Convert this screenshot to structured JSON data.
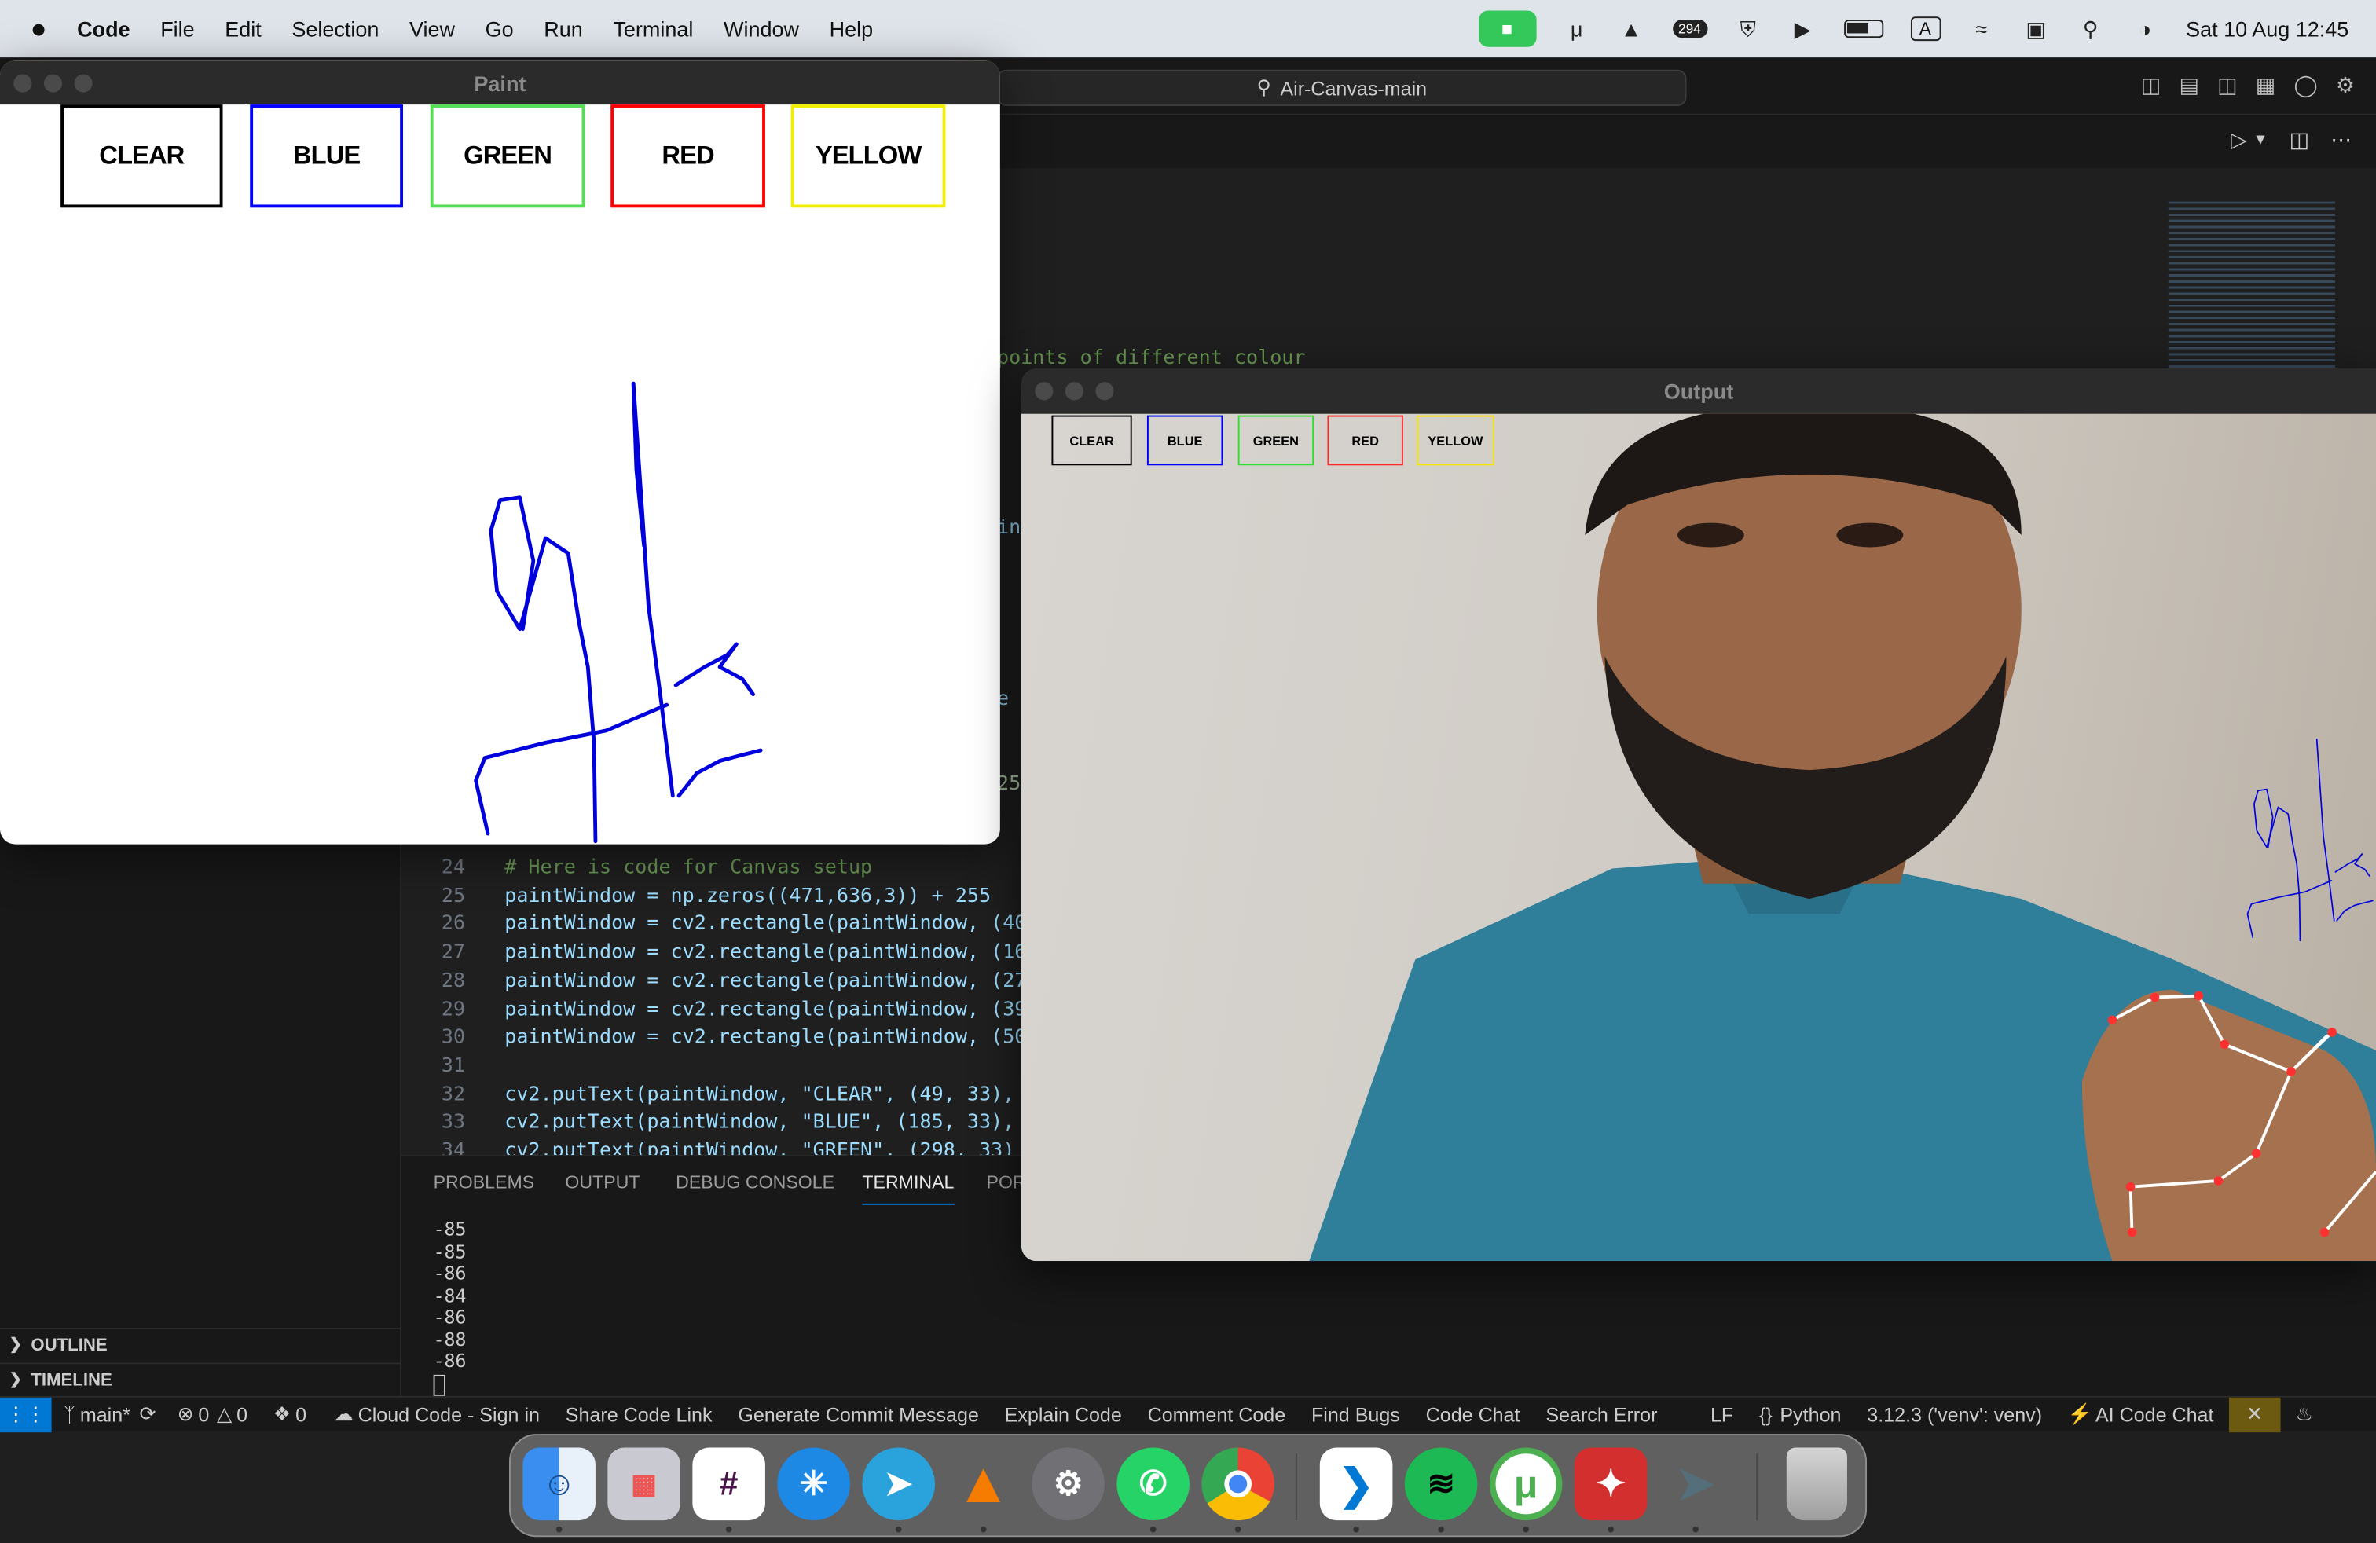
{
  "menubar": {
    "app_name": "Code",
    "items": [
      "File",
      "Edit",
      "Selection",
      "View",
      "Go",
      "Run",
      "Terminal",
      "Window",
      "Help"
    ],
    "badge_count": "294",
    "input_indicator": "A",
    "datetime": "Sat 10 Aug  12:45"
  },
  "vscode": {
    "command_center": "Air-Canvas-main",
    "code_fragments": {
      "comment_points": "points of different colour",
      "frag_a": "in",
      "frag_b": "e",
      "frag_c": "25"
    },
    "code_lines": [
      {
        "num": "24",
        "text": "# Here is code for Canvas setup"
      },
      {
        "num": "25",
        "text": "paintWindow = np.zeros((471,636,3)) + 255"
      },
      {
        "num": "26",
        "text": "paintWindow = cv2.rectangle(paintWindow, (40,"
      },
      {
        "num": "27",
        "text": "paintWindow = cv2.rectangle(paintWindow, (160,"
      },
      {
        "num": "28",
        "text": "paintWindow = cv2.rectangle(paintWindow, (275,"
      },
      {
        "num": "29",
        "text": "paintWindow = cv2.rectangle(paintWindow, (390,"
      },
      {
        "num": "30",
        "text": "paintWindow = cv2.rectangle(paintWindow, (505,"
      },
      {
        "num": "31",
        "text": ""
      },
      {
        "num": "32",
        "text": "cv2.putText(paintWindow, \"CLEAR\", (49, 33), c"
      },
      {
        "num": "33",
        "text": "cv2.putText(paintWindow, \"BLUE\", (185, 33), c"
      },
      {
        "num": "34",
        "text": "cv2.putText(paintWindow, \"GREEN\", (298, 33)"
      }
    ],
    "panel_tabs": [
      "PROBLEMS",
      "OUTPUT",
      "DEBUG CONSOLE",
      "TERMINAL",
      "POR"
    ],
    "terminal_lines": [
      "-85",
      "-85",
      "-86",
      "-84",
      "-86",
      "-88",
      "-86"
    ],
    "sidebar_sections": [
      "OUTLINE",
      "TIMELINE"
    ],
    "status": {
      "branch": "main*",
      "errors": "0",
      "warnings": "0",
      "ports": "0",
      "cloud_code": "Cloud Code - Sign in",
      "share": "Share Code Link",
      "commit": "Generate Commit Message",
      "explain": "Explain Code",
      "comment": "Comment Code",
      "bugs": "Find Bugs",
      "chat": "Code Chat",
      "search_error": "Search Error",
      "eol": "LF",
      "language": "Python",
      "interpreter": "3.12.3 ('venv': venv)",
      "ai_chat": "AI Code Chat"
    }
  },
  "paint_window": {
    "title": "Paint",
    "buttons": [
      {
        "label": "CLEAR",
        "color": "#000000"
      },
      {
        "label": "BLUE",
        "color": "#0000ff"
      },
      {
        "label": "GREEN",
        "color": "#00ff00"
      },
      {
        "label": "RED",
        "color": "#ff0000"
      },
      {
        "label": "YELLOW",
        "color": "#ffff00"
      }
    ],
    "stroke_color": "#0000dd"
  },
  "output_window": {
    "title": "Output",
    "buttons": [
      {
        "label": "CLEAR",
        "color": "#000000"
      },
      {
        "label": "BLUE",
        "color": "#0000ff"
      },
      {
        "label": "GREEN",
        "color": "#00ff00"
      },
      {
        "label": "RED",
        "color": "#ff0000"
      },
      {
        "label": "YELLOW",
        "color": "#ffff00"
      }
    ]
  },
  "dock": {
    "apps": [
      "finder-icon",
      "launchpad-icon",
      "slack-icon",
      "safari-icon",
      "telegram-icon",
      "vlc-icon",
      "system-settings-icon",
      "whatsapp-icon",
      "chrome-icon",
      "vscode-icon",
      "spotify-icon",
      "utorrent-icon",
      "acrobat-icon",
      "rocket-icon",
      "trash-icon"
    ]
  }
}
